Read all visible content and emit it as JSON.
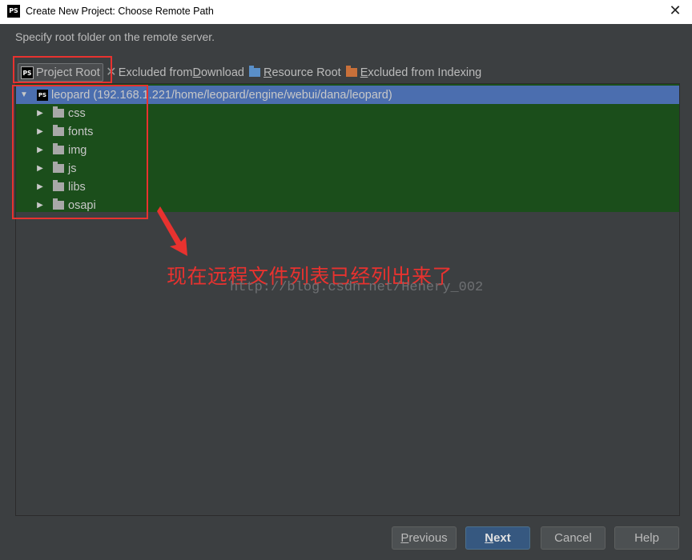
{
  "window": {
    "title": "Create New Project: Choose Remote Path",
    "icon_text": "PS",
    "close_glyph": "✕"
  },
  "prompt": "Specify root folder on the remote server.",
  "toolbar": {
    "project_root": "Project Root",
    "excluded_download_prefix": "Excluded from ",
    "excluded_download_underlined": "D",
    "excluded_download_suffix": "ownload",
    "resource_root_underlined": "R",
    "resource_root_suffix": "esource Root",
    "excluded_indexing_underlined": "E",
    "excluded_indexing_suffix": "xcluded from Indexing"
  },
  "tree": {
    "root": {
      "label": "leopard (192.168.1.221/home/leopard/engine/webui/dana/leopard)",
      "icon_text": "PS"
    },
    "children": [
      {
        "label": "css"
      },
      {
        "label": "fonts"
      },
      {
        "label": "img"
      },
      {
        "label": "js"
      },
      {
        "label": "libs"
      },
      {
        "label": "osapi"
      }
    ]
  },
  "annotation": "现在远程文件列表已经列出来了",
  "watermark": "http://blog.csdn.net/Henery_002",
  "buttons": {
    "previous_underlined": "P",
    "previous_suffix": "revious",
    "next_underlined": "N",
    "next_suffix": "ext",
    "cancel": "Cancel",
    "help": "Help"
  },
  "colors": {
    "background": "#3c3f41",
    "selection": "#4b6eaf",
    "project_root_highlight": "#1b4e1b",
    "annotation_red": "#e8322f",
    "resource_root_blue": "#5a8fc8",
    "excluded_orange": "#c8703a"
  }
}
